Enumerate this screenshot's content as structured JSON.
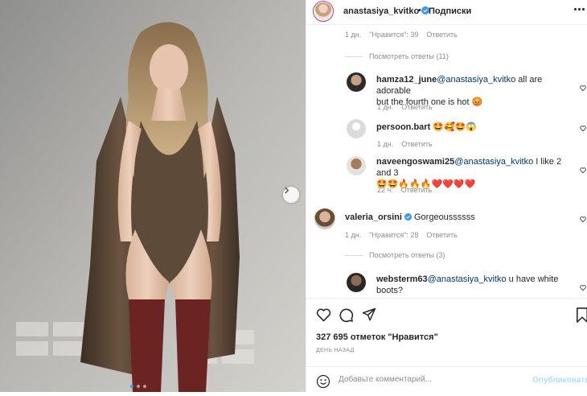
{
  "post": {
    "username": "anastasiya_kvitko",
    "separator": "•",
    "follow_label": "Подписки"
  },
  "comments": {
    "top_meta": {
      "age": "1 дн.",
      "likes": "\"Нравится\": 39",
      "reply": "Ответить"
    },
    "view_replies_1": "Посмотреть ответы (11)",
    "r1": {
      "user": "hamza12_june",
      "mention": "@anastasiya_kvitko",
      "text_a": " all are adorable",
      "text_b": "but the fourth one is hot 😡",
      "age": "1 дн.",
      "reply": "Ответить"
    },
    "r2": {
      "user": "persoon.bart",
      "text": " 🤩🥰🤩😱",
      "age": "1 дн.",
      "reply": "Ответить"
    },
    "r3": {
      "user": "naveengoswami25",
      "mention": "@anastasiya_kvitko",
      "text_a": " I like 2 and 3",
      "text_b": "🤩🤩🔥🔥🔥❤️❤️❤️❤️",
      "age": "22 ч.",
      "reply": "Ответить"
    },
    "c2": {
      "user": "valeria_orsini",
      "text": " Gorgeoussssss",
      "age": "1 дн.",
      "likes": "\"Нравится\": 28",
      "reply": "Ответить"
    },
    "view_replies_2": "Посмотреть ответы (3)",
    "r4": {
      "user": "websterm63",
      "mention": "@anastasiya_kvitko",
      "text_a": " u have white",
      "text_b": "boots?"
    }
  },
  "actions": {
    "likes_text": "327 695 отметок \"Нравится\"",
    "date_text": "ДЕНЬ НАЗАД",
    "comment_placeholder": "Добавьте комментарий...",
    "publish_label": "Опубликовать"
  },
  "carousel": {
    "dots": 3,
    "active_index": 0
  },
  "colors": {
    "accent": "#3897f0",
    "verified": "#3897f0",
    "mention": "#00376b",
    "muted": "#8e8e8e"
  },
  "icons": [
    "heart-icon",
    "comment-icon",
    "share-icon",
    "bookmark-icon",
    "emoji-icon",
    "chevron-right-icon",
    "verified-icon",
    "more-icon"
  ]
}
